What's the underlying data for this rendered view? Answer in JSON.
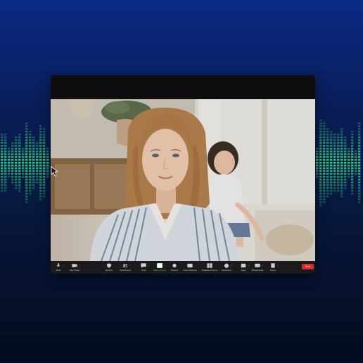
{
  "meeting": {
    "toolbar": {
      "items": [
        {
          "label": "Mute",
          "icon": "microphone-icon"
        },
        {
          "label": "Stop Video",
          "icon": "video-camera-icon"
        },
        {
          "label": "Security",
          "icon": "shield-icon"
        },
        {
          "label": "Participants",
          "icon": "participants-icon"
        },
        {
          "label": "Chat",
          "icon": "chat-bubble-icon"
        },
        {
          "label": "Share Screen",
          "icon": "share-screen-icon"
        },
        {
          "label": "Record",
          "icon": "record-icon"
        },
        {
          "label": "Show Captions",
          "icon": "captions-icon"
        },
        {
          "label": "Breakout Rooms",
          "icon": "breakout-rooms-icon"
        },
        {
          "label": "Reactions",
          "icon": "reactions-icon"
        },
        {
          "label": "Apps",
          "icon": "apps-icon"
        },
        {
          "label": "Whiteboards",
          "icon": "whiteboard-icon"
        },
        {
          "label": "Notes",
          "icon": "notes-icon"
        }
      ],
      "end_label": "End"
    }
  },
  "colors": {
    "background_top": "#0a2a86",
    "background_bottom": "#040b1e",
    "equalizer": "#2fcf7a",
    "share_green": "#2bd35a",
    "end_red": "#d92b2b",
    "toolbar": "#1b1b1b"
  }
}
